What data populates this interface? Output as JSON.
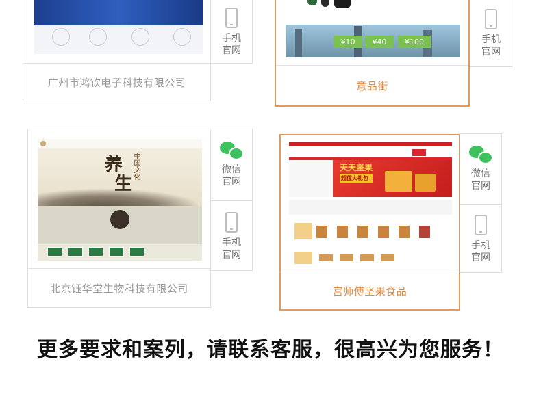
{
  "cards": [
    {
      "caption": "广州市鸿钦电子科技有限公司",
      "mobile_label": [
        "手机",
        "官网"
      ]
    },
    {
      "caption": "意品街",
      "mobile_label": [
        "手机",
        "官网"
      ],
      "price_tags": [
        "¥10",
        "¥40",
        "¥100"
      ]
    },
    {
      "caption": "北京钰华堂生物科技有限公司",
      "wechat_label": [
        "微信",
        "官网"
      ],
      "mobile_label": [
        "手机",
        "官网"
      ],
      "thumb_title": [
        "养",
        "生"
      ],
      "thumb_sub": "中国文化"
    },
    {
      "caption": "宫师傅坚果食品",
      "wechat_label": [
        "微信",
        "官网"
      ],
      "mobile_label": [
        "手机",
        "官网"
      ],
      "banner_text": [
        "天天坚果",
        "超值大礼包"
      ]
    }
  ],
  "footer": "更多要求和案列，请联系客服，很高兴为您服务！",
  "colors": {
    "accent": "#e08a3c",
    "border": "#dcdcdc",
    "wechat": "#3ec25d",
    "shop_red": "#d9272c"
  }
}
